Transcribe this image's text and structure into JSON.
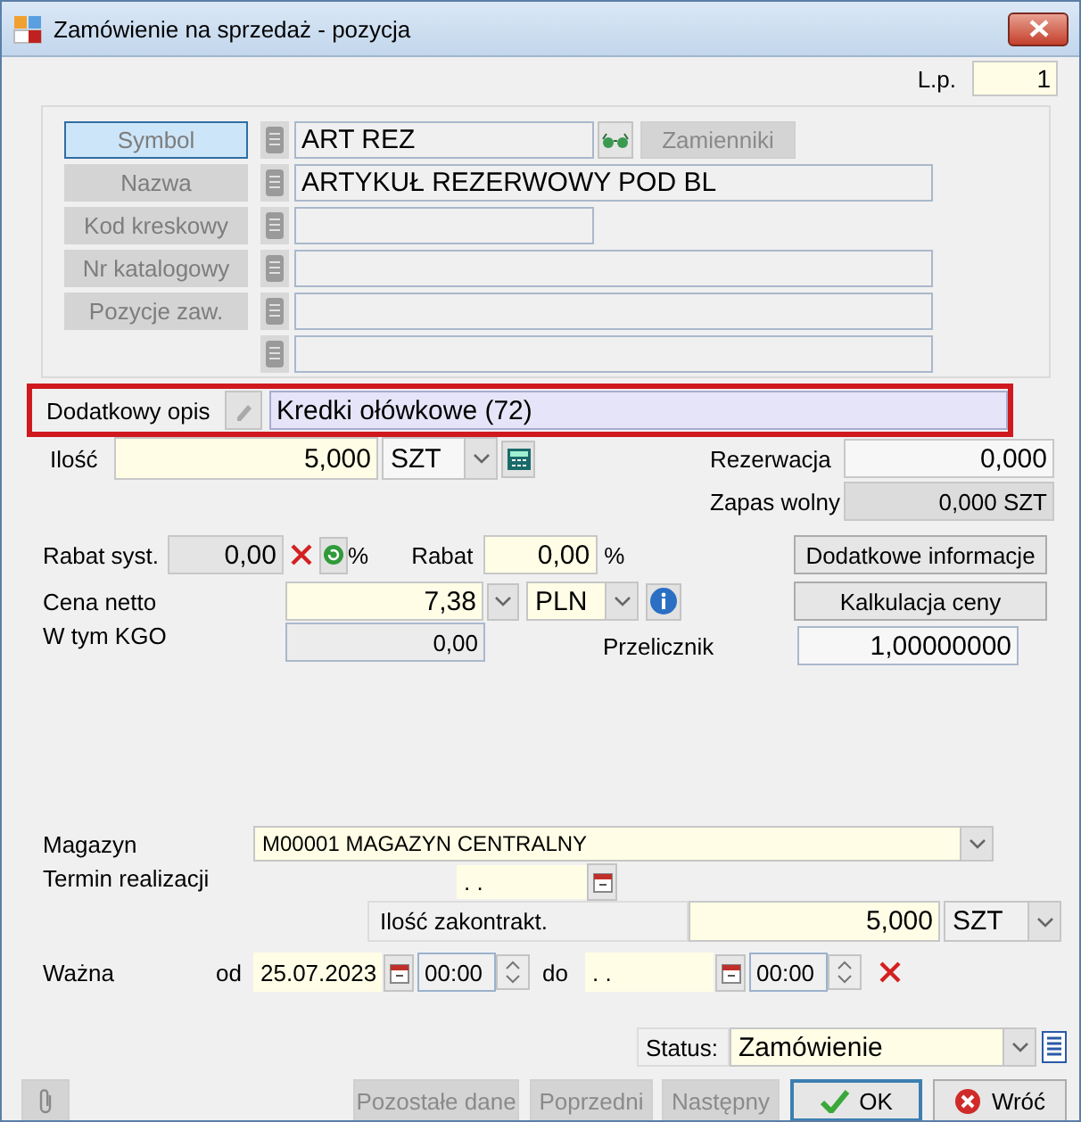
{
  "window": {
    "title": "Zamówienie na sprzedaż - pozycja"
  },
  "lp": {
    "label": "L.p.",
    "value": "1"
  },
  "identity_rows": [
    {
      "label": "Symbol",
      "selected": true,
      "value": "ART REZ",
      "kind": "short"
    },
    {
      "label": "Nazwa",
      "selected": false,
      "value": "ARTYKUŁ REZERWOWY POD BL",
      "kind": "long"
    },
    {
      "label": "Kod kreskowy",
      "selected": false,
      "kind": "short"
    },
    {
      "label": "Nr katalogowy",
      "selected": false,
      "kind": "long"
    },
    {
      "label": "Pozycje zaw.",
      "selected": false,
      "kind": "long"
    },
    {
      "kind": "long"
    }
  ],
  "substitutes_button": {
    "label": "Zamienniki",
    "disabled": true
  },
  "additional_description": {
    "label": "Dodatkowy opis",
    "value": "Kredki ołówkowe (72)"
  },
  "quantity": {
    "label": "Ilość",
    "value": "5,000",
    "unit": "SZT"
  },
  "reservation": {
    "label": "Rezerwacja",
    "value": "0,000"
  },
  "free_stock": {
    "label": "Zapas wolny",
    "value": "0,000 SZT"
  },
  "system_discount": {
    "label": "Rabat syst.",
    "value": "0,00",
    "unit": "%"
  },
  "discount": {
    "label": "Rabat",
    "value": "0,00",
    "unit": "%"
  },
  "net_price": {
    "label": "Cena netto",
    "value": "7,38",
    "currency": "PLN"
  },
  "kgo": {
    "label": "W tym KGO",
    "value": "0,00"
  },
  "converter": {
    "label": "Przelicznik",
    "value": "1,00000000"
  },
  "side_buttons": [
    "Dodatkowe informacje",
    "Kalkulacja ceny"
  ],
  "warehouse": {
    "label": "Magazyn",
    "value": "M00001 MAGAZYN CENTRALNY"
  },
  "due_date": {
    "label": "Termin realizacji",
    "value": ". ."
  },
  "contracted_quantity": {
    "label": "Ilość zakontrakt.",
    "value": "5,000",
    "unit": "SZT"
  },
  "valid": {
    "label": "Ważna",
    "from_label": "od",
    "from_date": "25.07.2023",
    "from_time": "00:00",
    "to_label": "do",
    "to_date": ". .",
    "to_time": "00:00"
  },
  "status": {
    "label": "Status:",
    "value": "Zamówienie"
  },
  "buttons": [
    {
      "label": "Pozostałe dane",
      "disabled": true,
      "kind": "plain"
    },
    {
      "label": "Poprzedni",
      "disabled": true,
      "kind": "plain"
    },
    {
      "label": "Następny",
      "disabled": true,
      "kind": "plain"
    },
    {
      "label": "OK",
      "disabled": false,
      "kind": "ok"
    },
    {
      "label": "Wróć",
      "disabled": false,
      "kind": "cancel"
    }
  ]
}
